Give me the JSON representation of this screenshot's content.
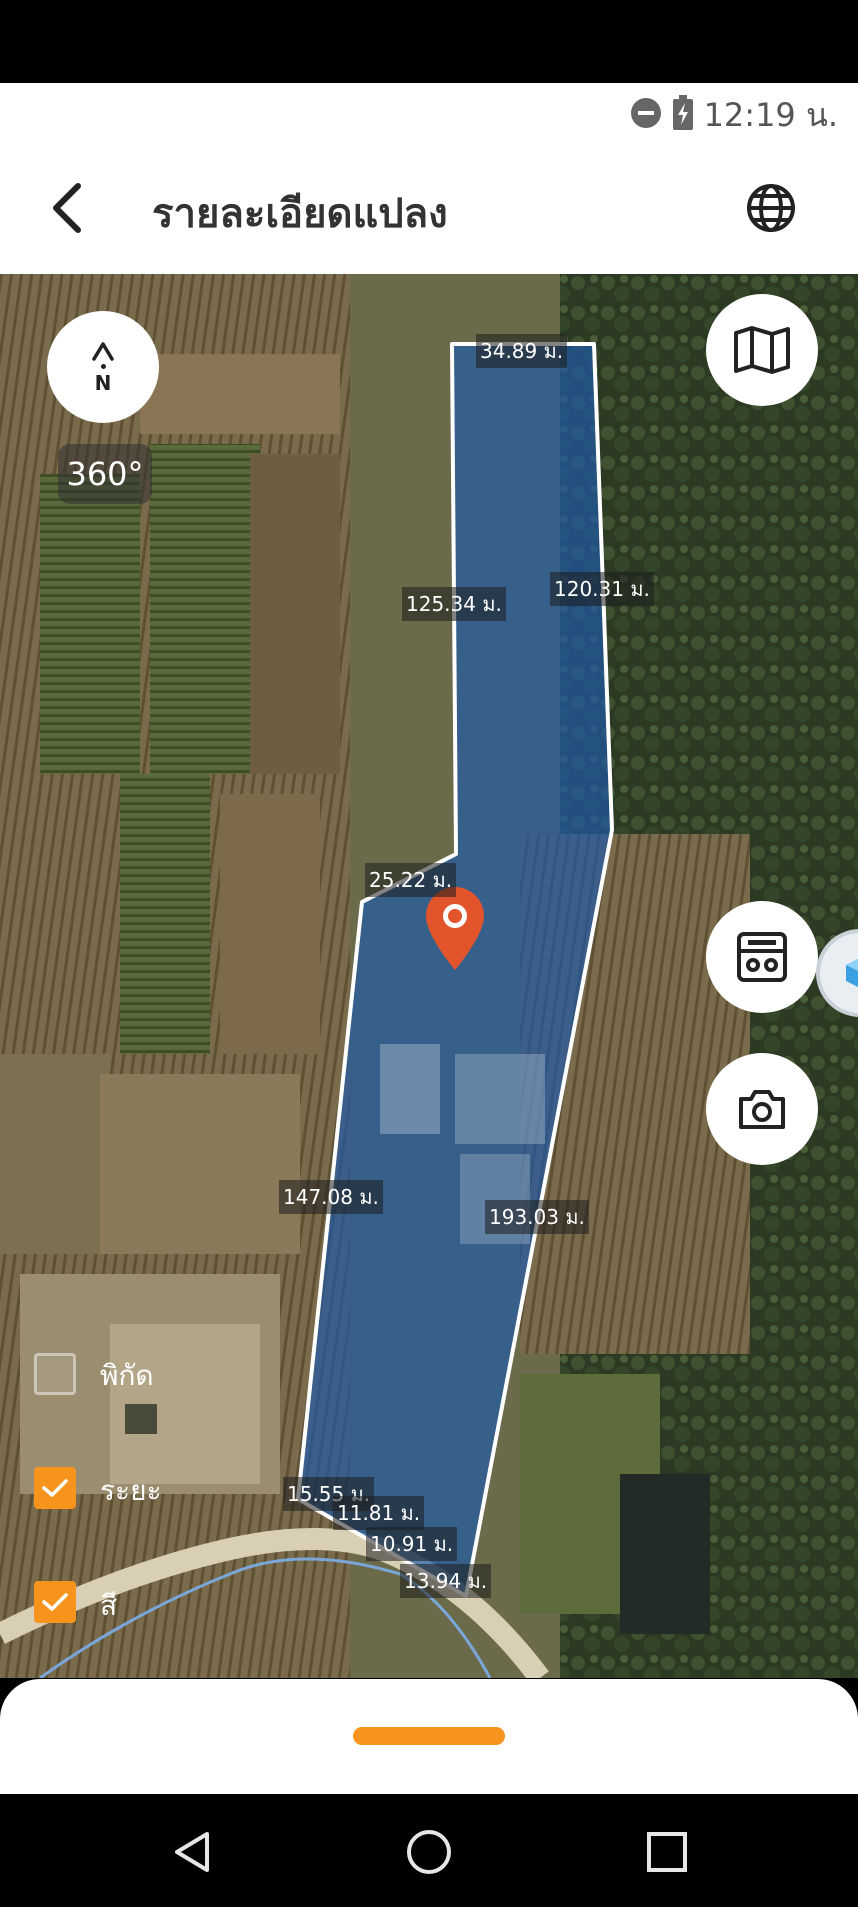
{
  "status": {
    "time": "12:19 น.",
    "icons": [
      "do-not-disturb-icon",
      "battery-charging-icon"
    ]
  },
  "header": {
    "title": "รายละเอียดแปลง",
    "back_icon": "chevron-left-icon",
    "globe_icon": "globe-icon"
  },
  "map": {
    "compass_letter": "N",
    "rotation_label": "360°",
    "parcel_color": "#1E5AA8",
    "marker_color": "#E2542B",
    "measurements": {
      "m1": "34.89 ม.",
      "m2": "120.31 ม.",
      "m3": "125.34 ม.",
      "m4": "25.22 ม.",
      "m5": "147.08 ม.",
      "m6": "193.03 ม.",
      "m7": "15.55 ม.",
      "m8": "11.81 ม.",
      "m9": "10.91 ม.",
      "m10": "13.94 ม."
    },
    "layers": {
      "coordinates": {
        "label": "พิกัด",
        "checked": false
      },
      "distance": {
        "label": "ระยะ",
        "checked": true
      },
      "color": {
        "label": "สี",
        "checked": true
      }
    },
    "buttons": [
      "map-icon",
      "calculator-icon",
      "camera-icon",
      "cube-icon"
    ]
  },
  "theme": {
    "accent": "#F7941D"
  },
  "navbar": [
    "back-triangle-icon",
    "home-circle-icon",
    "recents-square-icon"
  ]
}
